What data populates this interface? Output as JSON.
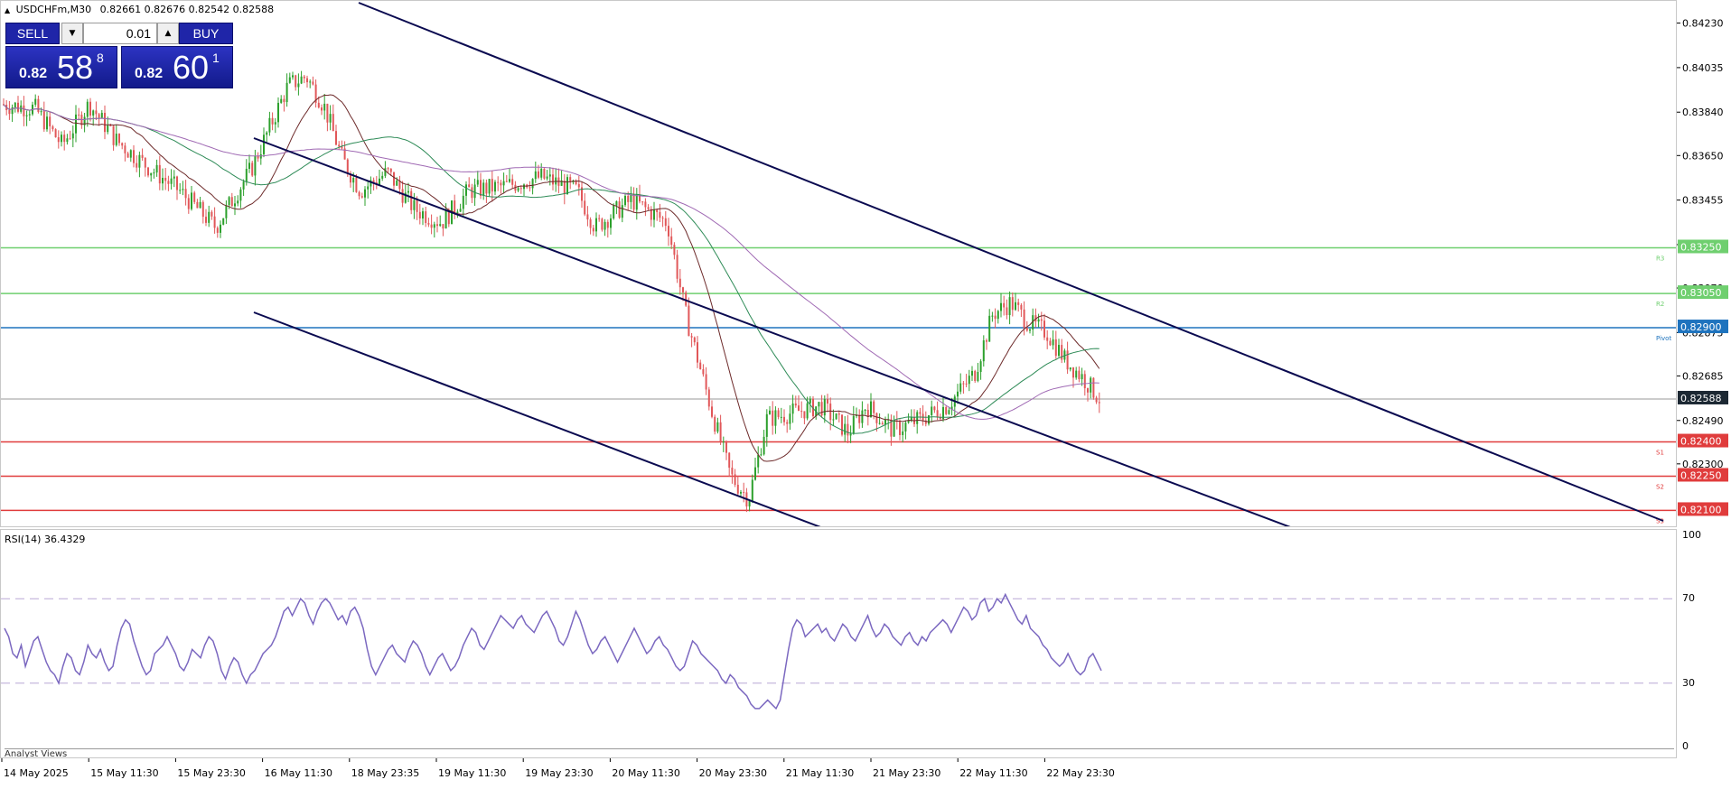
{
  "symbol_line": {
    "symbol": "USDCHFm,M30",
    "ohlc": "0.82661 0.82676 0.82542 0.82588"
  },
  "trade_panel": {
    "sell_label": "SELL",
    "buy_label": "BUY",
    "lot": "0.01",
    "sell_quote": {
      "small": "0.82",
      "big": "58",
      "sup": "8"
    },
    "buy_quote": {
      "small": "0.82",
      "big": "60",
      "sup": "1"
    }
  },
  "price_axis": {
    "ticks": [
      "0.84230",
      "0.84035",
      "0.83840",
      "0.83650",
      "0.83455",
      "0.83260",
      "0.83070",
      "0.82875",
      "0.82685",
      "0.82490",
      "0.82300"
    ],
    "range": [
      0.82078,
      0.84252
    ],
    "pivots": [
      {
        "label": "0.83250",
        "value": 0.8325,
        "color": "#6fcf6f",
        "tag": "R3"
      },
      {
        "label": "0.83050",
        "value": 0.8305,
        "color": "#6fcf6f",
        "tag": "R2"
      },
      {
        "label": "0.82900",
        "value": 0.829,
        "color": "#1e73be",
        "tag": "Pivot"
      },
      {
        "label": "0.82400",
        "value": 0.824,
        "color": "#e03c3c",
        "tag": "S1"
      },
      {
        "label": "0.82250",
        "value": 0.8225,
        "color": "#e03c3c",
        "tag": "S2"
      },
      {
        "label": "0.82100",
        "value": 0.821,
        "color": "#e03c3c",
        "tag": "S3"
      }
    ],
    "current": {
      "label": "0.82588",
      "value": 0.82588
    }
  },
  "rsi": {
    "title": "RSI(14) 36.4329",
    "levels": [
      "100",
      "70",
      "30",
      "0"
    ],
    "series": [
      56,
      52,
      44,
      42,
      48,
      38,
      44,
      50,
      52,
      46,
      40,
      36,
      34,
      30,
      38,
      44,
      42,
      36,
      34,
      40,
      48,
      44,
      42,
      46,
      40,
      36,
      38,
      48,
      56,
      60,
      58,
      50,
      44,
      38,
      34,
      36,
      44,
      46,
      48,
      52,
      48,
      44,
      38,
      36,
      40,
      46,
      44,
      42,
      48,
      52,
      50,
      44,
      36,
      32,
      38,
      42,
      40,
      34,
      30,
      34,
      36,
      40,
      44,
      46,
      48,
      52,
      58,
      64,
      66,
      62,
      66,
      70,
      68,
      62,
      58,
      64,
      68,
      70,
      68,
      64,
      60,
      62,
      58,
      64,
      66,
      62,
      56,
      46,
      38,
      34,
      38,
      42,
      46,
      48,
      44,
      42,
      40,
      46,
      50,
      48,
      44,
      38,
      34,
      38,
      42,
      44,
      40,
      36,
      38,
      42,
      48,
      52,
      56,
      54,
      48,
      46,
      50,
      54,
      58,
      62,
      60,
      58,
      56,
      60,
      62,
      58,
      56,
      54,
      58,
      62,
      64,
      60,
      56,
      50,
      48,
      52,
      58,
      64,
      60,
      54,
      48,
      44,
      46,
      50,
      52,
      48,
      44,
      40,
      44,
      48,
      52,
      56,
      52,
      48,
      44,
      46,
      50,
      52,
      48,
      46,
      42,
      38,
      36,
      38,
      44,
      50,
      48,
      44,
      42,
      40,
      38,
      36,
      32,
      30,
      34,
      32,
      28,
      26,
      24,
      20,
      18,
      18,
      20,
      22,
      20,
      18,
      22,
      34,
      46,
      56,
      60,
      58,
      52,
      54,
      56,
      58,
      54,
      56,
      52,
      50,
      54,
      58,
      56,
      52,
      50,
      54,
      58,
      62,
      56,
      52,
      54,
      58,
      56,
      52,
      50,
      48,
      52,
      54,
      50,
      48,
      52,
      50,
      54,
      56,
      58,
      60,
      58,
      54,
      58,
      62,
      66,
      64,
      60,
      62,
      68,
      70,
      64,
      66,
      70,
      68,
      72,
      68,
      64,
      60,
      58,
      62,
      56,
      54,
      52,
      48,
      46,
      42,
      40,
      38,
      40,
      44,
      40,
      36,
      34,
      36,
      42,
      44,
      40,
      36
    ]
  },
  "time_axis": [
    "14 May 2025",
    "15 May 11:30",
    "15 May 23:30",
    "16 May 11:30",
    "18 May 23:35",
    "19 May 11:30",
    "19 May 23:30",
    "20 May 11:30",
    "20 May 23:30",
    "21 May 11:30",
    "21 May 23:30",
    "22 May 11:30",
    "22 May 23:30"
  ],
  "colors": {
    "bull": "#2ca02c",
    "bear": "#e15759",
    "trend": "#0a0a50",
    "rsi": "#7b68c0",
    "ma1": "#6d2a2a",
    "ma2": "#2e8b57",
    "ma3": "#a06ab4"
  },
  "analyst_label": "Analyst Views"
}
